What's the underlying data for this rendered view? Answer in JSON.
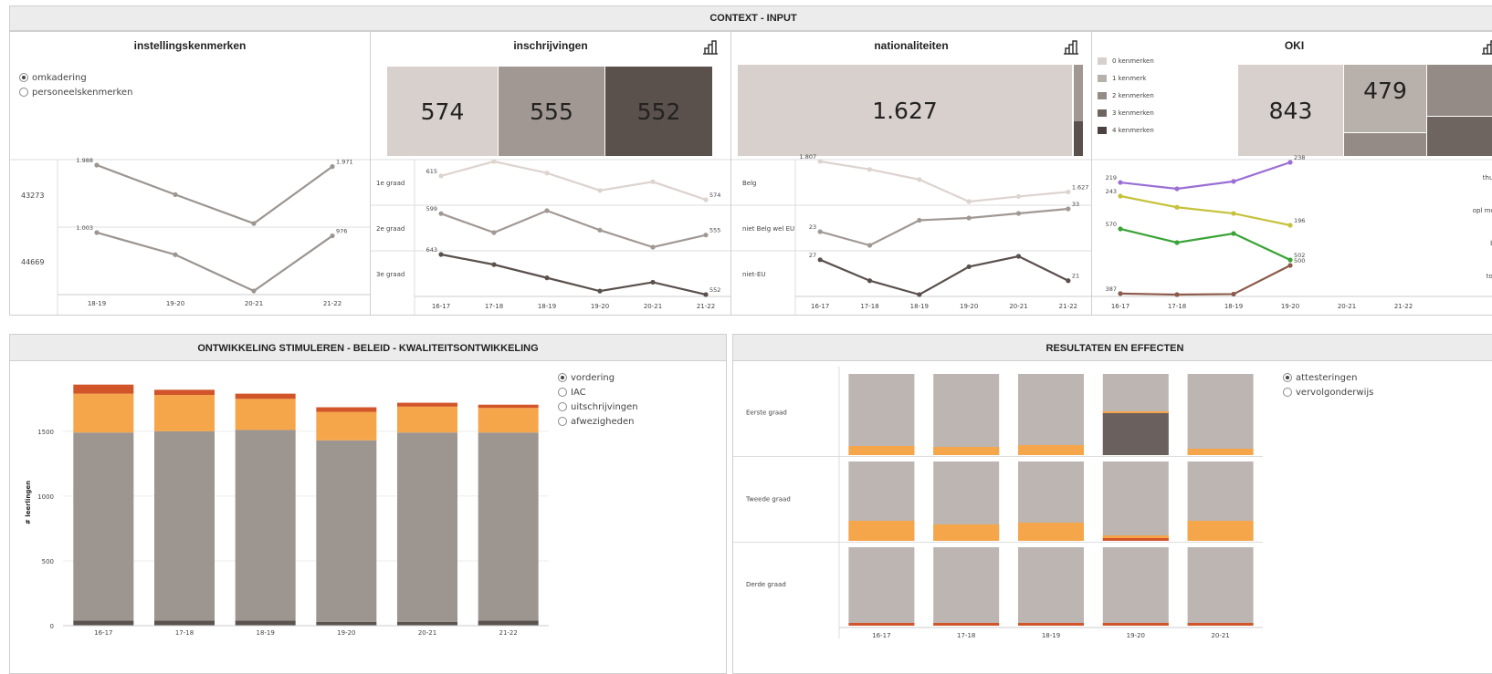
{
  "context_header": "CONTEXT - INPUT",
  "dev_header": "ONTWIKKELING STIMULEREN - BELEID - KWALITEITSONTWIKKELING",
  "results_header": "RESULTATEN EN EFFECTEN",
  "inst": {
    "title": "instellingskenmerken",
    "options": [
      {
        "label": "omkadering",
        "selected": true
      },
      {
        "label": "personeelskenmerken",
        "selected": false
      }
    ],
    "row_labels": [
      "43273",
      "44669"
    ]
  },
  "inschr": {
    "title": "inschrijvingen",
    "tiles": [
      "574",
      "555",
      "552"
    ]
  },
  "nat": {
    "title": "nationaliteiten",
    "tile": "1.627"
  },
  "oki": {
    "title": "OKI",
    "legend": [
      "0 kenmerken",
      "1 kenmerk",
      "2 kenmerken",
      "3 kenmerken",
      "4 kenmerken"
    ],
    "tiles": [
      "843",
      "479"
    ],
    "row_labels": [
      "thuis",
      "opl moe",
      "bu",
      "toel"
    ]
  },
  "dev": {
    "options": [
      {
        "label": "vordering",
        "selected": true
      },
      {
        "label": "IAC",
        "selected": false
      },
      {
        "label": "uitschrijvingen",
        "selected": false
      },
      {
        "label": "afwezigheden",
        "selected": false
      }
    ]
  },
  "res": {
    "options": [
      {
        "label": "attesteringen",
        "selected": true
      },
      {
        "label": "vervolgonderwijs",
        "selected": false
      }
    ]
  },
  "chart_data": [
    {
      "type": "line",
      "title": "instellingskenmerken",
      "categories": [
        "18-19",
        "19-20",
        "20-21",
        "21-22"
      ],
      "series": [
        {
          "values": [
            1988,
            1650,
            1320,
            1971
          ],
          "labels": [
            "1.988",
            "",
            "",
            "1.971"
          ]
        },
        {
          "values": [
            1003,
            820,
            520,
            976
          ],
          "labels": [
            "1.003",
            "",
            "",
            "976"
          ]
        }
      ]
    },
    {
      "type": "line",
      "title": "inschrijvingen",
      "categories": [
        "16-17",
        "17-18",
        "18-19",
        "19-20",
        "20-21",
        "21-22"
      ],
      "rows": [
        "1e graad",
        "2e graad",
        "3e graad"
      ],
      "series": [
        {
          "values": [
            615,
            640,
            620,
            590,
            605,
            574
          ],
          "labels": [
            "615",
            "",
            "",
            "",
            "",
            "574"
          ]
        },
        {
          "values": [
            599,
            560,
            605,
            565,
            530,
            555
          ],
          "labels": [
            "599",
            "",
            "",
            "",
            "",
            "555"
          ]
        },
        {
          "values": [
            643,
            620,
            590,
            560,
            580,
            552
          ],
          "labels": [
            "643",
            "",
            "",
            "",
            "",
            "552"
          ]
        }
      ]
    },
    {
      "type": "line",
      "title": "nationaliteiten",
      "categories": [
        "16-17",
        "17-18",
        "18-19",
        "19-20",
        "20-21",
        "21-22"
      ],
      "rows": [
        "Belg",
        "niet Belg wel EU",
        "niet-EU"
      ],
      "series": [
        {
          "values": [
            1807,
            1760,
            1700,
            1570,
            1600,
            1627
          ],
          "labels": [
            "1.807",
            "",
            "",
            "",
            "",
            "1.627"
          ]
        },
        {
          "values": [
            23,
            17,
            28,
            29,
            31,
            33
          ],
          "labels": [
            "23",
            "",
            "",
            "",
            "",
            "33"
          ]
        },
        {
          "values": [
            27,
            21,
            17,
            25,
            28,
            21
          ],
          "labels": [
            "27",
            "",
            "",
            "",
            "",
            "21"
          ]
        }
      ]
    },
    {
      "type": "line",
      "title": "OKI",
      "categories": [
        "16-17",
        "17-18",
        "18-19",
        "19-20",
        "20-21",
        "21-22"
      ],
      "series": [
        {
          "color": "#9b6fd6",
          "values": [
            219,
            213,
            220,
            238
          ],
          "labels": [
            "219",
            "",
            "",
            "238"
          ]
        },
        {
          "color": "#c5c23a",
          "values": [
            243,
            225,
            215,
            196
          ],
          "labels": [
            "243",
            "",
            "",
            "196"
          ]
        },
        {
          "color": "#3aa336",
          "values": [
            570,
            540,
            560,
            502
          ],
          "labels": [
            "570",
            "",
            "",
            "502"
          ]
        },
        {
          "color": "#8c5a4a",
          "values": [
            387,
            383,
            385,
            500
          ],
          "labels": [
            "387",
            "",
            "",
            "500"
          ]
        }
      ]
    },
    {
      "type": "bar",
      "title": "ONTWIKKELING STIMULEREN - BELEID - KWALITEITSONTWIKKELING",
      "ylabel": "# leerlingen",
      "ylim": [
        0,
        1900
      ],
      "yticks": [
        0,
        500,
        1000,
        1500
      ],
      "categories": [
        "16-17",
        "17-18",
        "18-19",
        "19-20",
        "20-21",
        "21-22"
      ],
      "series": [
        {
          "color": "#5a5350",
          "values": [
            40,
            40,
            40,
            30,
            30,
            40
          ]
        },
        {
          "color": "#9c9590",
          "values": [
            1450,
            1460,
            1470,
            1400,
            1460,
            1450
          ]
        },
        {
          "color": "#f5a54a",
          "values": [
            300,
            280,
            240,
            220,
            200,
            190
          ]
        },
        {
          "color": "#d2552a",
          "values": [
            70,
            40,
            40,
            35,
            30,
            25
          ]
        }
      ]
    },
    {
      "type": "bar",
      "title": "RESULTATEN EN EFFECTEN",
      "rows": [
        "Eerste graad",
        "Tweede graad",
        "Derde graad"
      ],
      "categories": [
        "16-17",
        "17-18",
        "18-19",
        "19-20",
        "20-21"
      ]
    }
  ]
}
